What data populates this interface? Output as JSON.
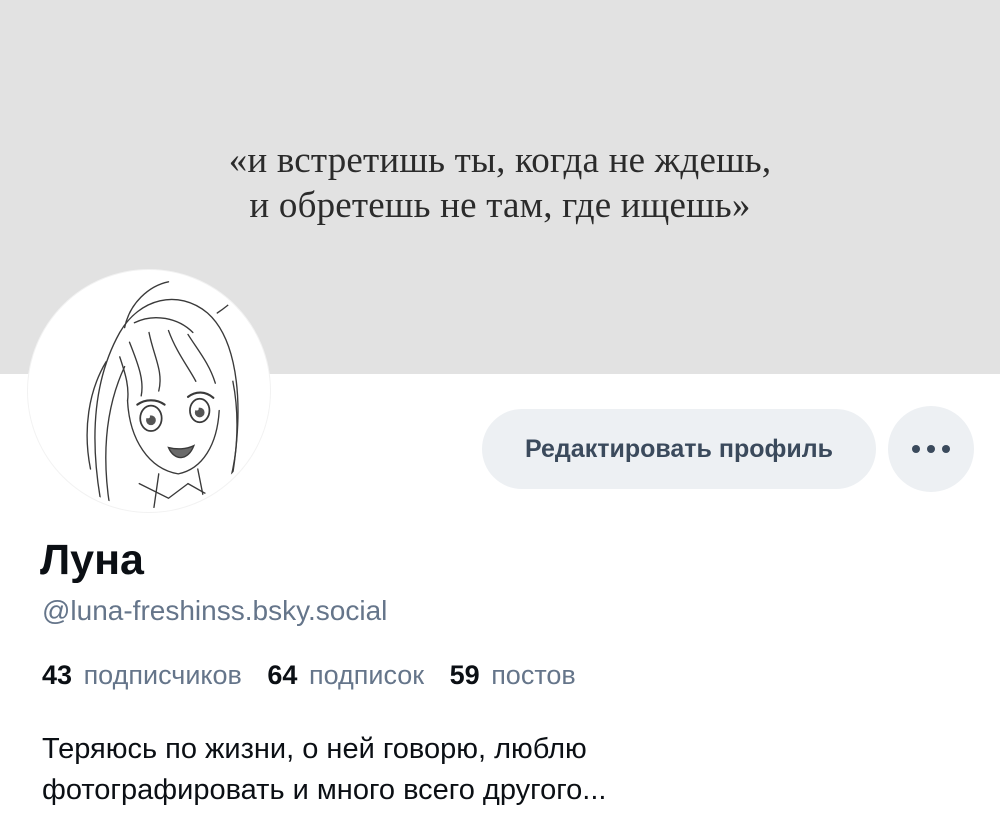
{
  "banner": {
    "quote_line1": "«и встретишь ты, когда не ждешь,",
    "quote_line2": "и обретешь не там, где ищешь»"
  },
  "profile": {
    "display_name": "Луна",
    "handle": "@luna-freshinss.bsky.social",
    "edit_label": "Редактировать профиль",
    "more_icon": "ellipsis-icon",
    "stats": {
      "followers_count": "43",
      "followers_label": "подписчиков",
      "following_count": "64",
      "following_label": "подписок",
      "posts_count": "59",
      "posts_label": "постов"
    },
    "bio_line1": "Теряюсь по жизни, о ней говорю, люблю",
    "bio_line2": "фотографировать и много всего другого..."
  },
  "colors": {
    "banner_bg": "#e2e2e2",
    "button_bg": "#edf0f3",
    "button_text": "#3b4a5c",
    "muted_text": "#65758a",
    "primary_text": "#0b0f14"
  }
}
